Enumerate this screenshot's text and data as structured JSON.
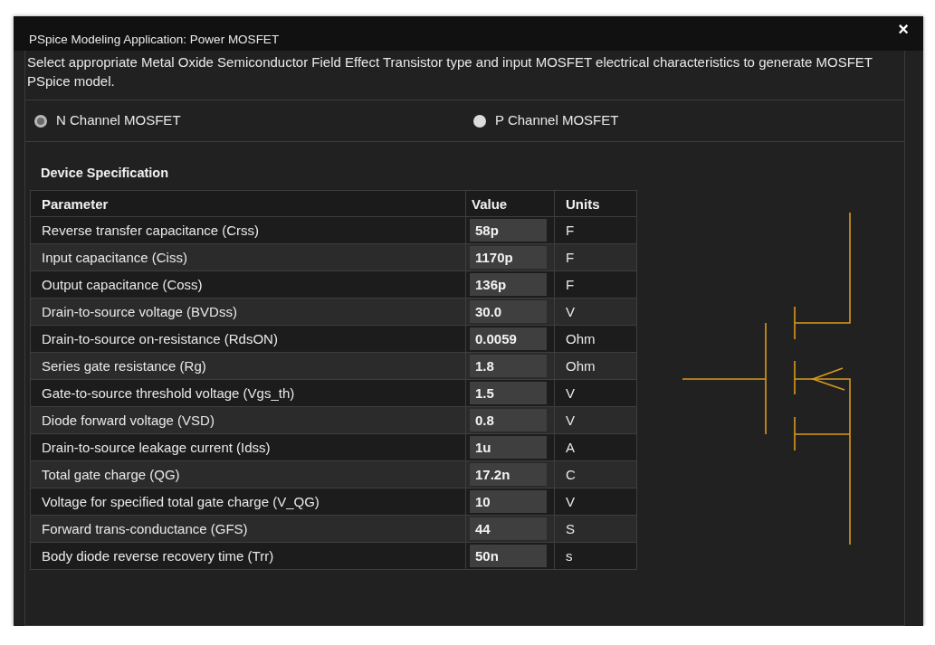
{
  "window": {
    "title": "PSpice Modeling Application: Power MOSFET",
    "close": "×"
  },
  "description": "Select appropriate Metal Oxide Semiconductor Field Effect Transistor type and input MOSFET electrical characteristics to generate MOSFET PSpice model.",
  "channel_types": [
    {
      "label": "N Channel MOSFET",
      "selected": true
    },
    {
      "label": "P Channel MOSFET",
      "selected": false
    }
  ],
  "section_title": "Device Specification",
  "table": {
    "columns": [
      "Parameter",
      "Value",
      "Units"
    ],
    "rows": [
      {
        "parameter": "Reverse transfer capacitance (Crss)",
        "value": "58p",
        "units": "F"
      },
      {
        "parameter": "Input capacitance (Ciss)",
        "value": "1170p",
        "units": "F"
      },
      {
        "parameter": "Output capacitance (Coss)",
        "value": "136p",
        "units": "F"
      },
      {
        "parameter": "Drain-to-source voltage (BVDss)",
        "value": "30.0",
        "units": "V"
      },
      {
        "parameter": "Drain-to-source on-resistance (RdsON)",
        "value": "0.0059",
        "units": "Ohm"
      },
      {
        "parameter": "Series gate resistance (Rg)",
        "value": "1.8",
        "units": "Ohm"
      },
      {
        "parameter": "Gate-to-source threshold voltage (Vgs_th)",
        "value": "1.5",
        "units": "V"
      },
      {
        "parameter": "Diode forward voltage (VSD)",
        "value": "0.8",
        "units": "V"
      },
      {
        "parameter": "Drain-to-source leakage current (Idss)",
        "value": "1u",
        "units": "A"
      },
      {
        "parameter": "Total gate charge (QG)",
        "value": "17.2n",
        "units": "C"
      },
      {
        "parameter": "Voltage for specified total gate charge (V_QG)",
        "value": "10",
        "units": "V"
      },
      {
        "parameter": "Forward trans-conductance (GFS)",
        "value": "44",
        "units": "S"
      },
      {
        "parameter": "Body diode reverse recovery time (Trr)",
        "value": "50n",
        "units": "s"
      }
    ]
  }
}
